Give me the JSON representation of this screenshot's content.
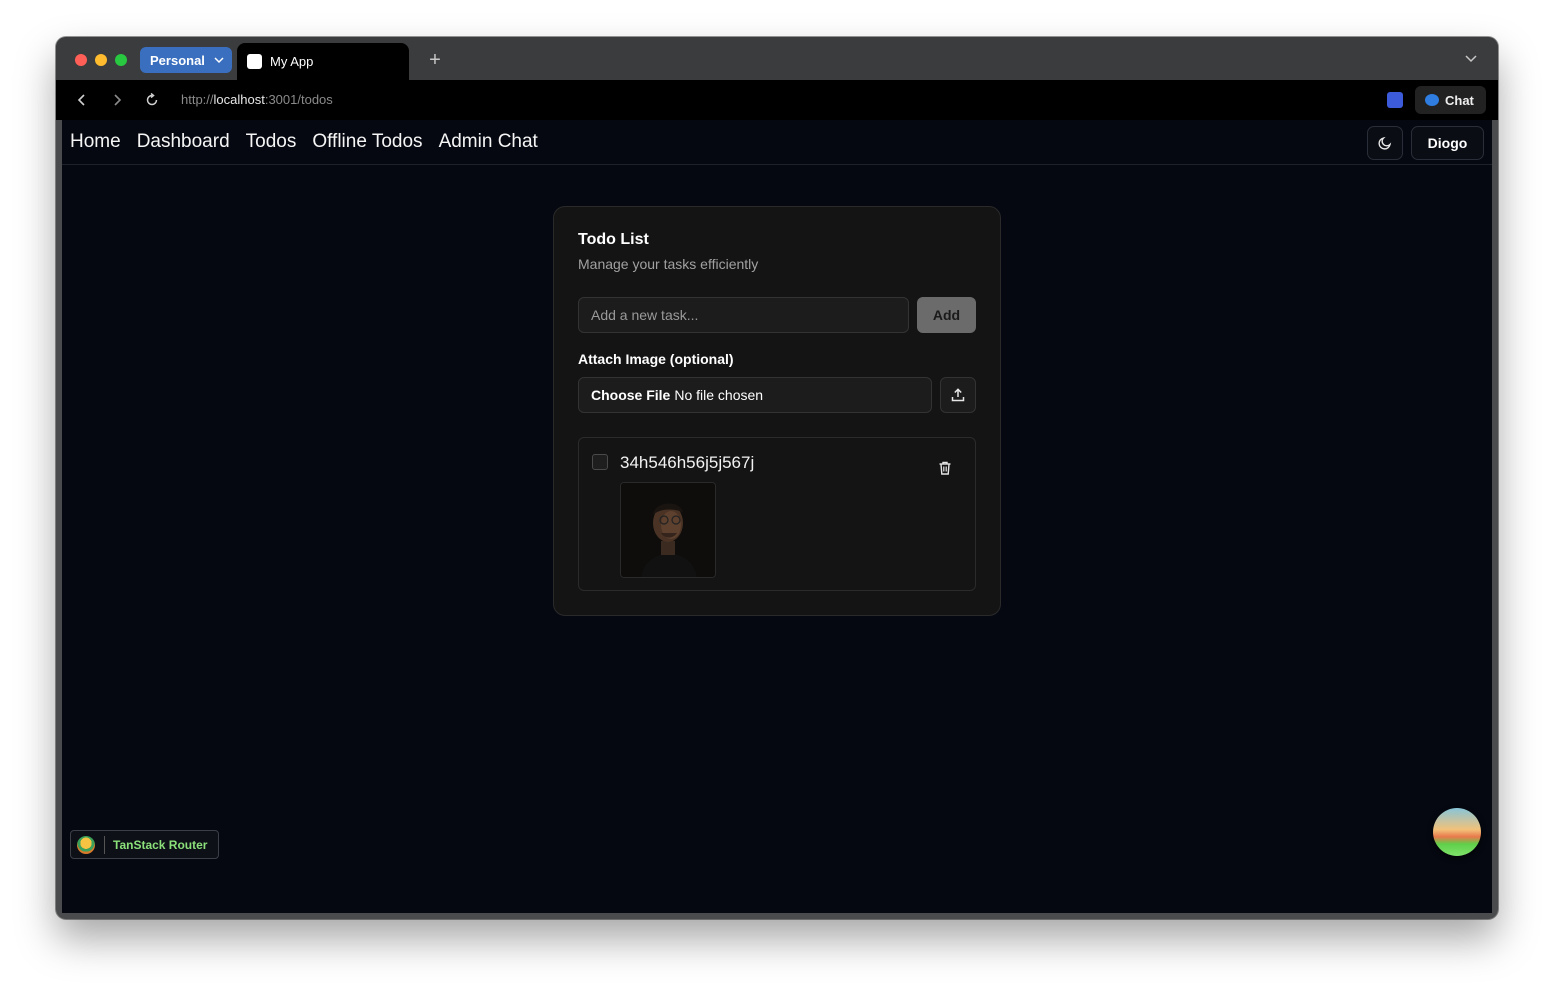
{
  "browser": {
    "profile_label": "Personal",
    "tab_title": "My App",
    "new_tab_symbol": "+",
    "url_scheme": "http://",
    "url_host": "localhost",
    "url_path": ":3001/todos",
    "chat_label": "Chat"
  },
  "nav": {
    "links": [
      "Home",
      "Dashboard",
      "Todos",
      "Offline Todos",
      "Admin Chat"
    ],
    "user_label": "Diogo"
  },
  "card": {
    "title": "Todo List",
    "description": "Manage your tasks efficiently",
    "input_placeholder": "Add a new task...",
    "add_label": "Add",
    "attach_label": "Attach Image (optional)",
    "file_choose_label": "Choose File",
    "file_status": "No file chosen"
  },
  "todos": [
    {
      "text": "34h546h56j5j567j",
      "completed": false,
      "has_image": true
    }
  ],
  "devtools": {
    "label": "TanStack Router"
  },
  "colors": {
    "page_bg": "#050810",
    "card_bg": "#141414",
    "profile_accent": "#3a6fbf",
    "devtools_text": "#8be07a"
  }
}
